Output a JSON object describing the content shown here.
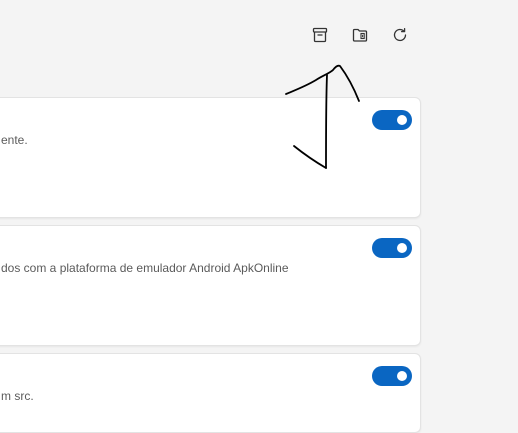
{
  "toolbar": {
    "icons": [
      "archive-icon",
      "folder-open-icon",
      "refresh-icon"
    ]
  },
  "cards": [
    {
      "description": "ente.",
      "toggle_on": true
    },
    {
      "description": "dos com a plataforma de emulador Android ApkOnline",
      "toggle_on": true
    },
    {
      "description": "m src.",
      "toggle_on": true
    }
  ],
  "colors": {
    "accent": "#0a66c2",
    "background": "#f4f4f4",
    "card": "#ffffff",
    "text": "#5b5b5b"
  }
}
